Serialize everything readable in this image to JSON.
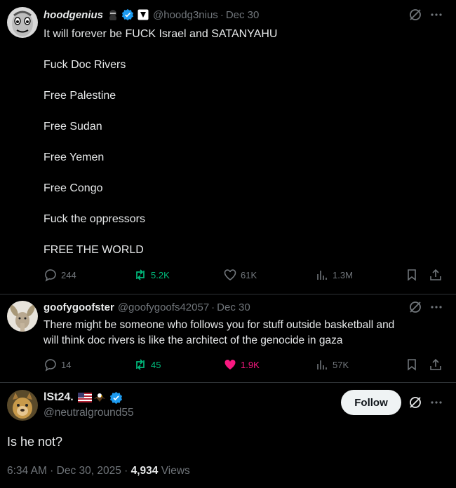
{
  "tweet1": {
    "display_name": "hoodgenius",
    "handle": "@hoodg3nius",
    "date": "Dec 30",
    "paragraphs": [
      "It will forever be FUCK Israel and SATANYAHU",
      "Fuck Doc Rivers",
      "Free Palestine",
      "Free Sudan",
      "Free Yemen",
      "Free Congo",
      "Fuck the oppressors",
      "FREE THE WORLD"
    ],
    "replies": "244",
    "reposts": "5.2K",
    "likes": "61K",
    "views": "1.3M"
  },
  "tweet2": {
    "display_name": "goofygoofster",
    "handle": "@goofygoofs42057",
    "date": "Dec 30",
    "text_line1": "There might be someone who follows you for stuff outside basketball and",
    "text_line2": "will think doc rivers is like the architect of the genocide in gaza",
    "replies": "14",
    "reposts": "45",
    "likes": "1.9K",
    "views": "57K"
  },
  "tweet3": {
    "display_name": "lSt24.",
    "handle": "@neutralground55",
    "follow_label": "Follow",
    "text": "Is he not?",
    "timestamp": "6:34 AM · Dec 30, 2025 · ",
    "views_count": "4,934",
    "views_label": " Views"
  },
  "colors": {
    "background": "#000000",
    "text": "#e7e9ea",
    "muted": "#71767b",
    "verified": "#1d9bf0",
    "repost_active": "#00ba7c",
    "like_active": "#f91880"
  },
  "icons": [
    "reply-icon",
    "repost-icon",
    "like-icon",
    "views-icon",
    "bookmark-icon",
    "share-icon",
    "grok-icon",
    "more-icon",
    "verified-icon"
  ]
}
